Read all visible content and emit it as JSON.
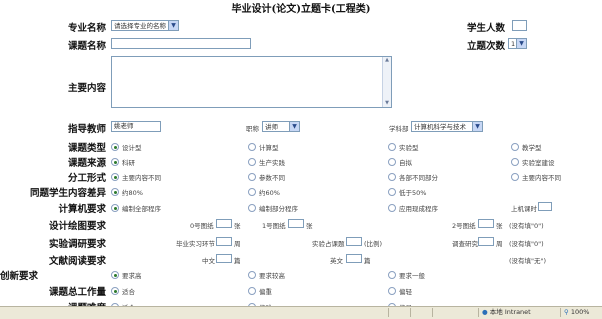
{
  "title": "毕业设计(论文)立题卡(工程类)",
  "major": {
    "label": "专业名称",
    "select_value": "请选择专业的名称"
  },
  "students": {
    "label": "学生人数",
    "value": ""
  },
  "topic": {
    "label": "课题名称",
    "value": ""
  },
  "times": {
    "label": "立题次数",
    "select_value": "1"
  },
  "content": {
    "label": "主要内容"
  },
  "teacher": {
    "label": "指导教师",
    "value": "姚老师",
    "title_label": "职称",
    "title_value": "讲师",
    "dept_label": "学科部",
    "dept_value": "计算机科学与技术"
  },
  "rows": [
    {
      "label": "课题类型",
      "options": [
        "设计型",
        "计算型",
        "实验型",
        "教学型"
      ],
      "selected": 0
    },
    {
      "label": "课题来源",
      "options": [
        "科研",
        "生产实践",
        "自拟",
        "实验室建设"
      ],
      "selected": 0
    },
    {
      "label": "分工形式",
      "options": [
        "主要内容不同",
        "参数不同",
        "各部不同部分",
        "主要内容不同"
      ],
      "selected": 0
    },
    {
      "label": "同题学生内容差异",
      "options": [
        "约80%",
        "约60%",
        "低于50%"
      ],
      "selected": 0
    },
    {
      "label": "计算机要求",
      "options": [
        "编制全部程序",
        "编制部分程序",
        "应用现成程序"
      ],
      "selected": 0,
      "extra": "上机课时"
    }
  ],
  "drawing": {
    "label": "设计绘图要求",
    "f1": "0号图纸",
    "f2": "1号图纸",
    "f3": "2号图纸",
    "unit": "张",
    "note": "(没有填\"0\")"
  },
  "experiment": {
    "label": "实验调研要求",
    "f1": "毕业实习环节",
    "f2": "实验占课题",
    "f3": "调查研究",
    "unit1": "周",
    "unit2": "(比例)",
    "note": "(没有填\"0\")"
  },
  "reading": {
    "label": "文献阅读要求",
    "f1": "中文",
    "f2": "英文",
    "unit": "篇",
    "note": "(没有填\"无\")"
  },
  "innovation": {
    "label": "创新要求",
    "options": [
      "要求高",
      "要求较高",
      "要求一般"
    ],
    "selected": 0
  },
  "workload": {
    "label": "课题总工作量",
    "options": [
      "适合",
      "偏重",
      "偏轻"
    ],
    "selected": 0
  },
  "difficulty": {
    "label": "课题难度",
    "options": [
      "适合",
      "偏难",
      "偏易"
    ],
    "selected": 0
  },
  "status": {
    "zone": "本地 Intranet",
    "zoom": "100%"
  }
}
